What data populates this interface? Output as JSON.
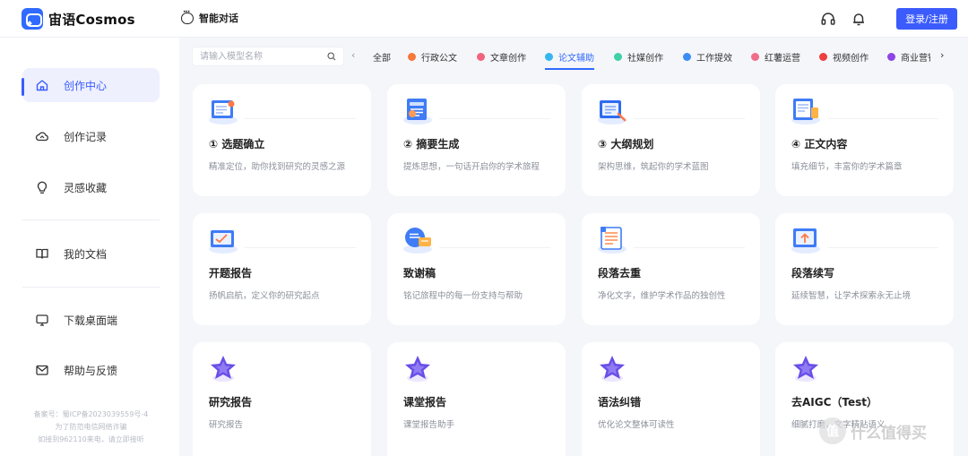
{
  "app": {
    "name": "宙语Cosmos"
  },
  "header": {
    "chat_label": "智能对话",
    "login_label": "登录/注册"
  },
  "sidebar": {
    "items": [
      {
        "label": "创作中心",
        "icon": "home-icon"
      },
      {
        "label": "创作记录",
        "icon": "cloud-icon"
      },
      {
        "label": "灵感收藏",
        "icon": "lightbulb-icon"
      },
      {
        "label": "我的文档",
        "icon": "book-icon"
      },
      {
        "label": "下载桌面端",
        "icon": "monitor-icon"
      },
      {
        "label": "帮助与反馈",
        "icon": "envelope-icon"
      }
    ],
    "footer_lines": [
      "备案号：蜀ICP备2023039559号-4",
      "为了防范电信网络诈骗",
      "如接到962110来电，请立即接听"
    ]
  },
  "search": {
    "placeholder": "请输入模型名称"
  },
  "tabs": [
    {
      "label": "全部",
      "color": ""
    },
    {
      "label": "行政公文",
      "color": "#f5793a"
    },
    {
      "label": "文章创作",
      "color": "#f0657d"
    },
    {
      "label": "论文辅助",
      "color": "#35b6f0"
    },
    {
      "label": "社媒创作",
      "color": "#3fd0a8"
    },
    {
      "label": "工作提效",
      "color": "#3b8df5"
    },
    {
      "label": "红薯运营",
      "color": "#f06e8a"
    },
    {
      "label": "视频创作",
      "color": "#ee3f3f"
    },
    {
      "label": "商业营销",
      "color": "#8d45e6"
    }
  ],
  "active_tab": "论文辅助",
  "cards": [
    {
      "title": "① 选题确立",
      "desc": "精准定位，助你找到研究的灵感之源",
      "icon": "topic-icon"
    },
    {
      "title": "② 摘要生成",
      "desc": "提炼思想，一句话开启你的学术旅程",
      "icon": "abstract-icon"
    },
    {
      "title": "③ 大纲规划",
      "desc": "架构思维，筑起你的学术蓝图",
      "icon": "outline-icon"
    },
    {
      "title": "④ 正文内容",
      "desc": "填充细节，丰富你的学术篇章",
      "icon": "content-icon"
    },
    {
      "title": "开题报告",
      "desc": "扬帆启航，定义你的研究起点",
      "icon": "proposal-icon"
    },
    {
      "title": "致谢稿",
      "desc": "铭记旅程中的每一份支持与帮助",
      "icon": "thanks-icon"
    },
    {
      "title": "段落去重",
      "desc": "净化文字，维护学术作品的独创性",
      "icon": "dedupe-icon"
    },
    {
      "title": "段落续写",
      "desc": "延续智慧，让学术探索永无止境",
      "icon": "continue-icon"
    },
    {
      "title": "研究报告",
      "desc": "研究报告",
      "icon": "star-icon"
    },
    {
      "title": "课堂报告",
      "desc": "课堂报告助手",
      "icon": "star-icon"
    },
    {
      "title": "语法纠错",
      "desc": "优化论文整体可读性",
      "icon": "star-icon"
    },
    {
      "title": "去AIGC（Test）",
      "desc": "细腻打磨，文字精贴语义",
      "icon": "star-icon"
    }
  ],
  "watermark": {
    "badge": "值",
    "text": "什么值得买"
  }
}
